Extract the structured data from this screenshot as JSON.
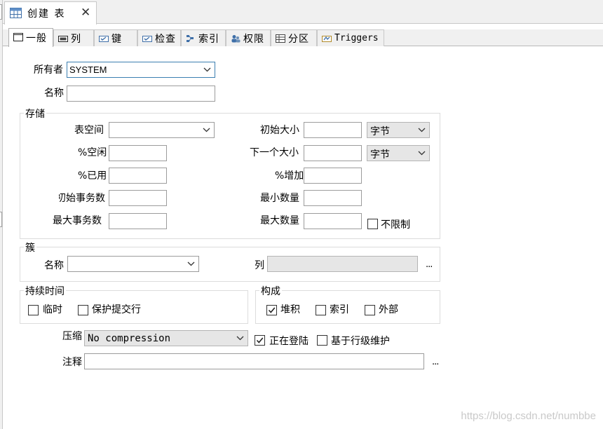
{
  "window": {
    "tab_title": "创建 表",
    "tab_icon": "table-icon",
    "close_icon": "close-icon"
  },
  "tabs": [
    {
      "label": "一般",
      "icon": "window-icon",
      "active": true
    },
    {
      "label": "列",
      "icon": "column-icon"
    },
    {
      "label": "键",
      "icon": "key-icon"
    },
    {
      "label": "检查",
      "icon": "check-icon"
    },
    {
      "label": "索引",
      "icon": "index-icon"
    },
    {
      "label": "权限",
      "icon": "users-icon"
    },
    {
      "label": "分区",
      "icon": "partition-icon"
    },
    {
      "label": "Triggers",
      "icon": "trigger-icon"
    }
  ],
  "general": {
    "owner_label": "所有者",
    "owner_value": "SYSTEM",
    "name_label": "名称",
    "name_value": ""
  },
  "storage": {
    "title": "存储",
    "tablespace_label": "表空间",
    "tablespace_value": "",
    "pct_free_label": "%空闲",
    "pct_used_label": "%已用",
    "ini_trans_label": "初始事务数",
    "max_trans_label": "最大事务数",
    "initial_size_label": "初始大小",
    "initial_size_unit": "字节",
    "next_size_label": "下一个大小",
    "next_size_unit": "字节",
    "pct_increase_label": "%增加",
    "min_extents_label": "最小数量",
    "max_extents_label": "最大数量",
    "unlimited_label": "不限制",
    "unlimited_checked": false
  },
  "cluster": {
    "title": "簇",
    "name_label": "名称",
    "name_value": "",
    "columns_label": "列",
    "columns_value": "",
    "ellipsis": "..."
  },
  "duration": {
    "title": "持续时间",
    "temporary_label": "临时",
    "temporary_checked": false,
    "preserve_commit_label": "保护提交行",
    "preserve_commit_checked": false
  },
  "organization": {
    "title": "构成",
    "heap_label": "堆积",
    "heap_checked": true,
    "index_label": "索引",
    "index_checked": false,
    "external_label": "外部",
    "external_checked": false
  },
  "compression": {
    "label": "压缩",
    "value": "No compression",
    "logging_label": "正在登陆",
    "logging_checked": true,
    "row_movement_label": "基于行级维护",
    "row_movement_checked": false
  },
  "comment": {
    "label": "注释",
    "value": "",
    "ellipsis": "..."
  },
  "watermark": "https://blog.csdn.net/numbbe",
  "colors": {
    "focus_border": "#3c7fb1",
    "tab_bg": "#f0f0f0"
  }
}
